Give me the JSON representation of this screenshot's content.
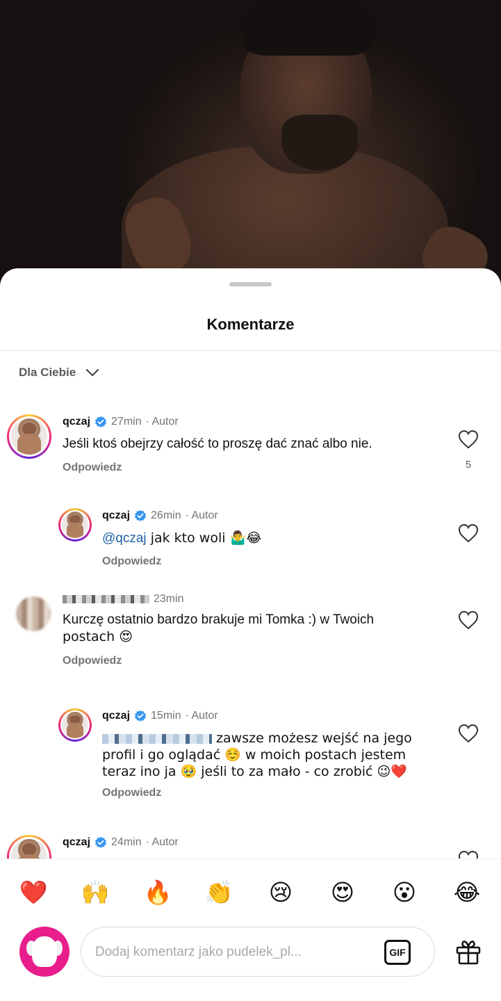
{
  "sheet": {
    "title": "Komentarze",
    "sort_label": "Dla Ciebie"
  },
  "comments": [
    {
      "username": "qczaj",
      "time": "27min",
      "author_tag": "· Autor",
      "text": "Jeśli ktoś obejrzy całość to proszę dać znać albo nie.",
      "reply_label": "Odpowiedz",
      "likes": "5"
    },
    {
      "username": "qczaj",
      "time": "26min",
      "author_tag": "· Autor",
      "mention": "@qczaj",
      "text": " jak kto woli 🤷‍♂️😂",
      "reply_label": "Odpowiedz"
    },
    {
      "time": "23min",
      "text_line1": "Kurczę ostatnio bardzo brakuje mi Tomka :) w Twoich",
      "text_line2": "postach 😍",
      "reply_label": "Odpowiedz"
    },
    {
      "username": "qczaj",
      "time": "15min",
      "author_tag": "· Autor",
      "text_line1": " zawsze możesz wejść na jego",
      "text_line2": "profil i go oglądać ☺️ w moich postach jestem",
      "text_line3": "teraz ino ja 🥹 jeśli to za mało - co zrobić 😉❤️",
      "reply_label": "Odpowiedz"
    },
    {
      "username": "qczaj",
      "time": "24min",
      "author_tag": "· Autor"
    }
  ],
  "reactions": [
    {
      "name": "heart-emoji",
      "glyph": "❤️"
    },
    {
      "name": "raising-hands-emoji",
      "glyph": "🙌"
    },
    {
      "name": "fire-emoji",
      "glyph": "🔥"
    },
    {
      "name": "clapping-emoji",
      "glyph": "👏"
    },
    {
      "name": "crying-emoji",
      "glyph": "😢"
    },
    {
      "name": "heart-eyes-emoji",
      "glyph": "😍"
    },
    {
      "name": "surprised-emoji",
      "glyph": "😮"
    },
    {
      "name": "laughing-emoji",
      "glyph": "😂"
    }
  ],
  "input": {
    "placeholder": "Dodaj komentarz jako pudelek_pl...",
    "gif_label": "GIF"
  },
  "colors": {
    "verified": "#3897f0",
    "mention": "#1f5fa6",
    "pudelek_avatar": "#e81e8c"
  }
}
